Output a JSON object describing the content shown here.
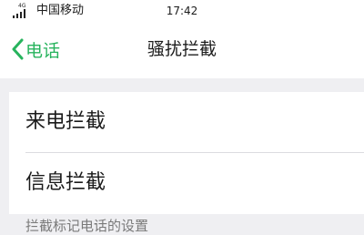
{
  "status_bar": {
    "network_type": "4G",
    "carrier": "中国移动",
    "time": "17:42"
  },
  "nav": {
    "back_label": "电话",
    "title": "骚扰拦截",
    "accent_color": "#27b35d"
  },
  "list": {
    "items": [
      {
        "label": "来电拦截"
      },
      {
        "label": "信息拦截"
      }
    ]
  },
  "footer": {
    "hint": "拦截标记电话的设置"
  }
}
